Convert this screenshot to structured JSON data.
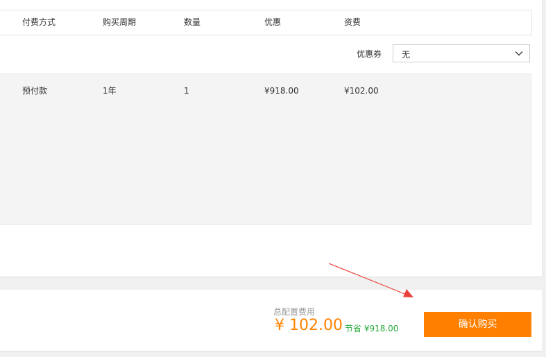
{
  "table": {
    "headers": [
      "付费方式",
      "购买周期",
      "数量",
      "优惠",
      "资费"
    ],
    "row": [
      "预付款",
      "1年",
      "1",
      "¥918.00",
      "¥102.00"
    ]
  },
  "coupon": {
    "label": "优惠券",
    "selected": "无",
    "icon": "chevron-down-icon"
  },
  "summary": {
    "total_label": "总配置费用",
    "total_price": "¥ 102.00",
    "savings": "节省 ¥918.00",
    "confirm_label": "确认购买"
  },
  "colors": {
    "accent": "#ff8000",
    "price": "#ff8200",
    "savings": "#25a83a",
    "annotation": "#e8413c"
  }
}
